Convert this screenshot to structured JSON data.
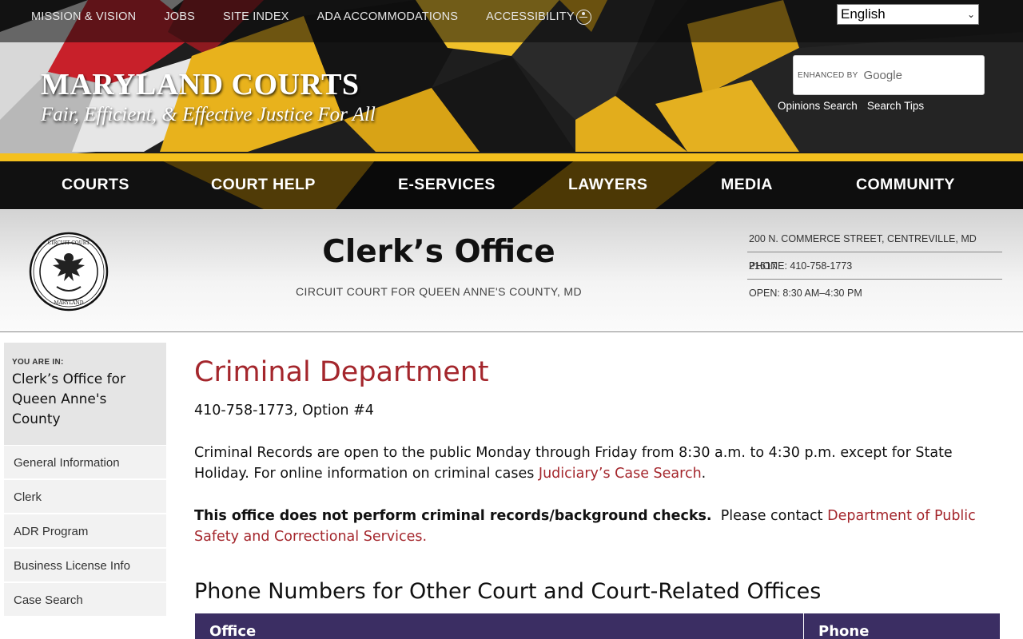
{
  "top_nav": {
    "links": [
      "MISSION & VISION",
      "JOBS",
      "SITE INDEX",
      "ADA ACCOMMODATIONS",
      "ACCESSIBILITY"
    ]
  },
  "language": {
    "selected": "English"
  },
  "brand": {
    "title": "MARYLAND COURTS",
    "tagline": "Fair, Efficient, & Effective Justice For All"
  },
  "search": {
    "enhanced_by": "ENHANCED BY",
    "provider": "Google",
    "links": [
      "Opinions Search",
      "Search Tips"
    ]
  },
  "main_nav": [
    "COURTS",
    "COURT HELP",
    "E-SERVICES",
    "LAWYERS",
    "MEDIA",
    "COMMUNITY"
  ],
  "office": {
    "title": "Clerk’s Office",
    "subtitle": "CIRCUIT COURT FOR QUEEN ANNE'S COUNTY, MD",
    "address": "200 N. COMMERCE STREET, CENTREVILLE, MD 21617",
    "phone": "PHONE: 410-758-1773",
    "hours": "OPEN: 8:30 AM–4:30 PM"
  },
  "sidebar": {
    "you_are_in_label": "YOU ARE IN:",
    "location": "Clerk’s Office for Queen Anne's County",
    "items": [
      "General Information",
      "Clerk",
      "ADR Program",
      "Business License Info",
      "Case Search"
    ]
  },
  "content": {
    "title": "Criminal Department",
    "phone_line": "410-758-1773, Option #4",
    "records_text": "Criminal Records are open to the public Monday through Friday from 8:30 a.m. to 4:30 p.m. except for State Holiday.  For online information on criminal cases ",
    "case_search_link": "Judiciary’s Case Search",
    "period": ".",
    "notice_bold": "This office does not perform criminal records/background checks.",
    "notice_text": "  Please contact ",
    "dpscs_link": "Department of Public Safety and Correctional Services.",
    "phones_heading": "Phone Numbers for Other Court and Court-Related Offices",
    "table_headers": [
      "Office",
      "Phone"
    ]
  },
  "colors": {
    "accent_red": "#a4262c",
    "gold": "#f4c01e",
    "table_header": "#3b2e63"
  }
}
